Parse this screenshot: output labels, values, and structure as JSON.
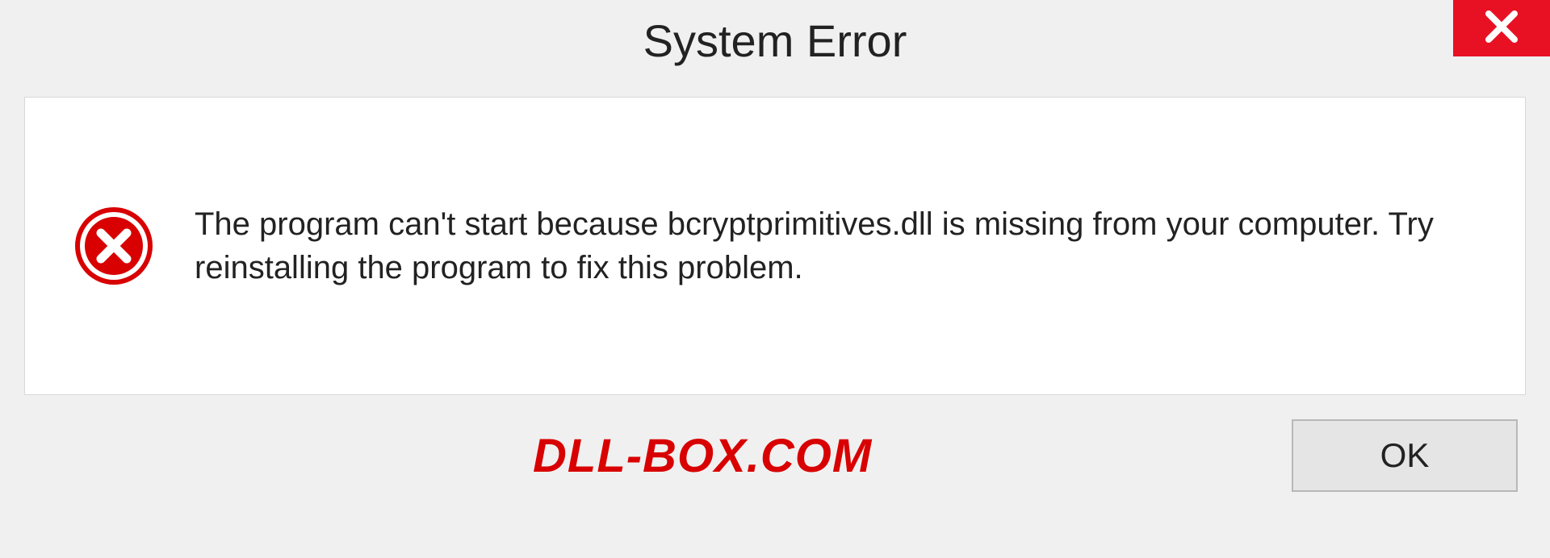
{
  "dialog": {
    "title": "System Error",
    "message": "The program can't start because bcryptprimitives.dll is missing from your computer. Try reinstalling the program to fix this problem.",
    "ok_label": "OK"
  },
  "watermark": "DLL-BOX.COM"
}
